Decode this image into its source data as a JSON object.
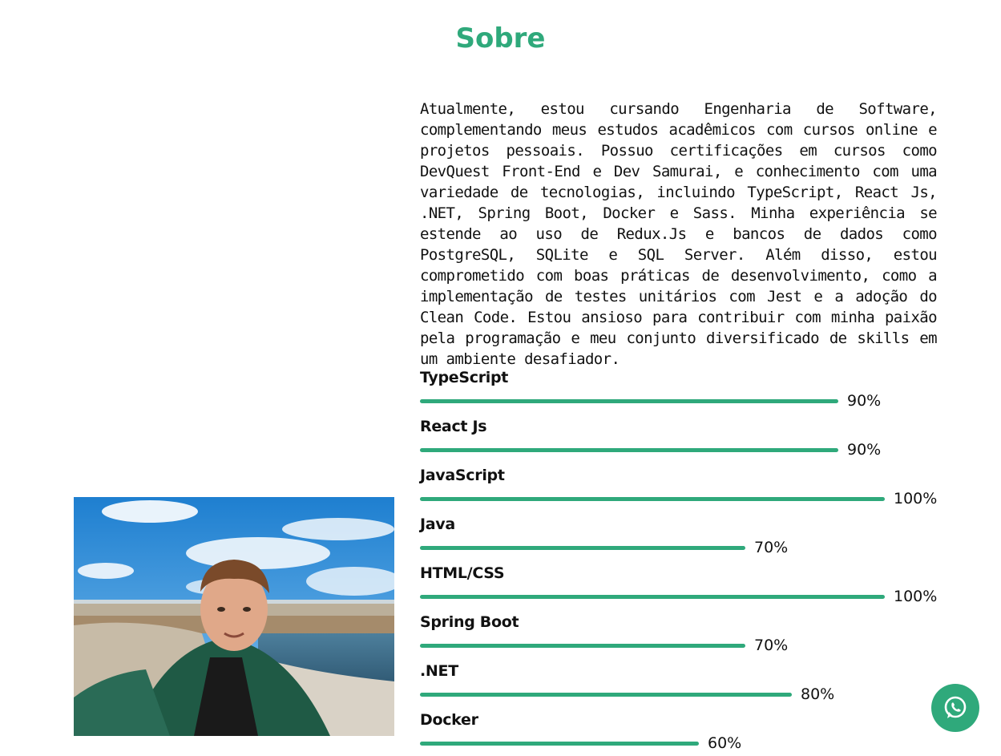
{
  "section": {
    "title": "Sobre",
    "accent_color": "#2fa97b"
  },
  "about": {
    "text": "Atualmente, estou cursando Engenharia de Software, complementando meus estudos acadêmicos com cursos online e projetos pessoais. Possuo certificações em cursos como DevQuest Front-End e Dev Samurai, e conhecimento com uma variedade de tecnologias, incluindo TypeScript, React Js, .NET, Spring Boot, Docker e Sass. Minha experiência se estende ao uso de Redux.Js e bancos de dados como PostgreSQL, SQLite e SQL Server. Além disso, estou comprometido com boas práticas de desenvolvimento, como a implementação de testes unitários com Jest e a adoção do Clean Code. Estou ansioso para contribuir com minha paixão pela programação e meu conjunto diversificado de skills em um ambiente desafiador."
  },
  "skills": [
    {
      "name": "TypeScript",
      "label": "90%",
      "percent": 90
    },
    {
      "name": "React Js",
      "label": "90%",
      "percent": 90
    },
    {
      "name": "JavaScript",
      "label": "100%",
      "percent": 100
    },
    {
      "name": "Java",
      "label": "70%",
      "percent": 70
    },
    {
      "name": "HTML/CSS",
      "label": "100%",
      "percent": 100
    },
    {
      "name": "Spring Boot",
      "label": "70%",
      "percent": 70
    },
    {
      "name": ".NET",
      "label": "80%",
      "percent": 80
    },
    {
      "name": "Docker",
      "label": "60%",
      "percent": 60
    }
  ],
  "whatsapp": {
    "icon": "whatsapp-icon"
  }
}
